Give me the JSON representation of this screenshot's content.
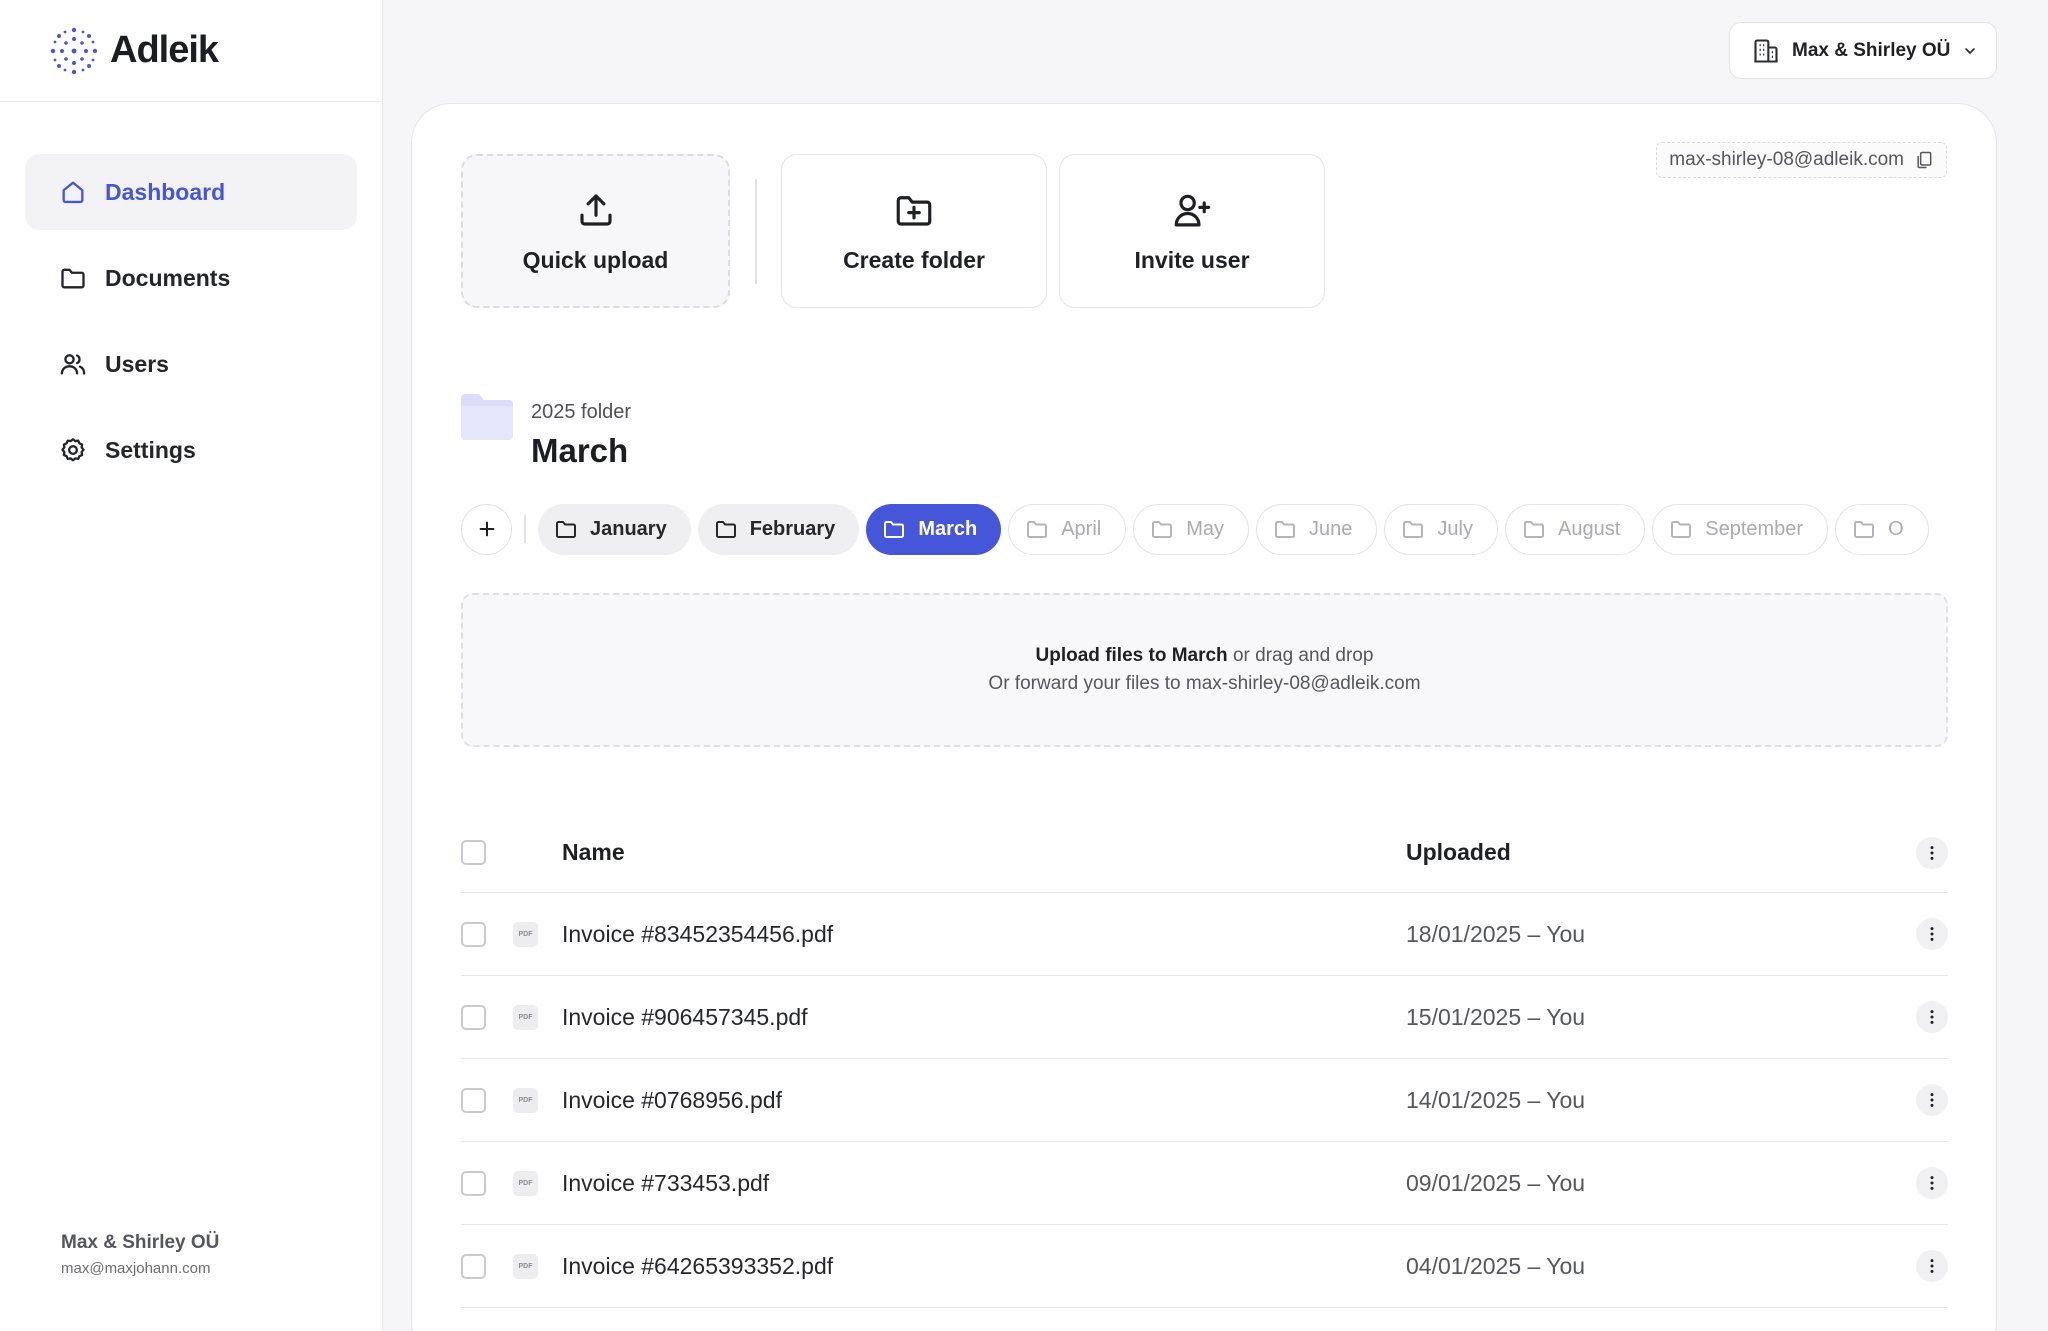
{
  "brand": {
    "name": "Adleik"
  },
  "sidebar": {
    "items": [
      {
        "label": "Dashboard",
        "icon": "home-icon",
        "active": true
      },
      {
        "label": "Documents",
        "icon": "folder-icon"
      },
      {
        "label": "Users",
        "icon": "users-icon"
      },
      {
        "label": "Settings",
        "icon": "gear-icon"
      }
    ],
    "footer": {
      "company": "Max & Shirley OÜ",
      "email": "max@maxjohann.com"
    }
  },
  "company_selector": {
    "label": "Max & Shirley OÜ",
    "icon": "building-icon"
  },
  "actions": {
    "quick_upload": "Quick upload",
    "create_folder": "Create folder",
    "invite_user": "Invite user"
  },
  "forward_email": "max-shirley-08@adleik.com",
  "folder": {
    "parent": "2025 folder",
    "title": "March"
  },
  "months": [
    "January",
    "February",
    "March",
    "April",
    "May",
    "June",
    "July",
    "August",
    "September",
    "O"
  ],
  "dropzone": {
    "strong": "Upload files to March",
    "rest": "or drag and drop",
    "line2": "Or forward your files to max-shirley-08@adleik.com"
  },
  "table": {
    "columns": {
      "name": "Name",
      "uploaded": "Uploaded"
    },
    "file_badge": "PDF",
    "rows": [
      {
        "name": "Invoice #83452354456.pdf",
        "uploaded": "18/01/2025  –  You"
      },
      {
        "name": "Invoice #906457345.pdf",
        "uploaded": "15/01/2025  –  You"
      },
      {
        "name": "Invoice #0768956.pdf",
        "uploaded": "14/01/2025  –  You"
      },
      {
        "name": "Invoice #733453.pdf",
        "uploaded": "09/01/2025  –  You"
      },
      {
        "name": "Invoice #64265393352.pdf",
        "uploaded": "04/01/2025  –  You"
      }
    ]
  },
  "colors": {
    "accent": "#4656d8",
    "text": "#1f2024",
    "muted": "#55565e"
  }
}
